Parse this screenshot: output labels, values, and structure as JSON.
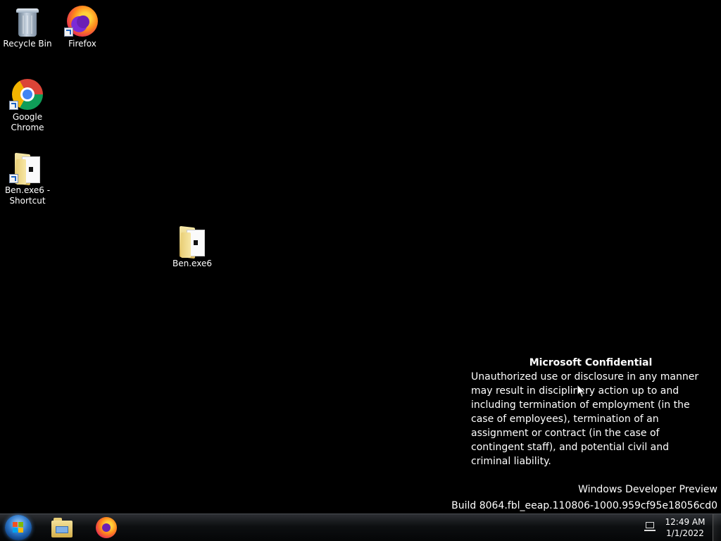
{
  "desktop_icons": {
    "recycle_bin": "Recycle Bin",
    "firefox": "Firefox",
    "google_chrome": "Google Chrome",
    "ben_shortcut": "Ben.exe6 - Shortcut",
    "ben_folder": "Ben.exe6"
  },
  "watermark": {
    "title": "Microsoft Confidential",
    "body": "Unauthorized use or disclosure in any manner may result in disciplinary action up to and including termination of employment (in the case of employees), termination of an assignment or contract (in the case of contingent staff), and potential civil and criminal liability.",
    "edition": "Windows Developer Preview",
    "build": "Build 8064.fbl_eeap.110806-1000.959cf95e18056cd0"
  },
  "taskbar": {
    "time": "12:49 AM",
    "date": "1/1/2022",
    "pinned": [
      "file-explorer",
      "firefox"
    ]
  },
  "colors": {
    "desktop_background": "#000000",
    "taskbar": "#0d0f11"
  }
}
